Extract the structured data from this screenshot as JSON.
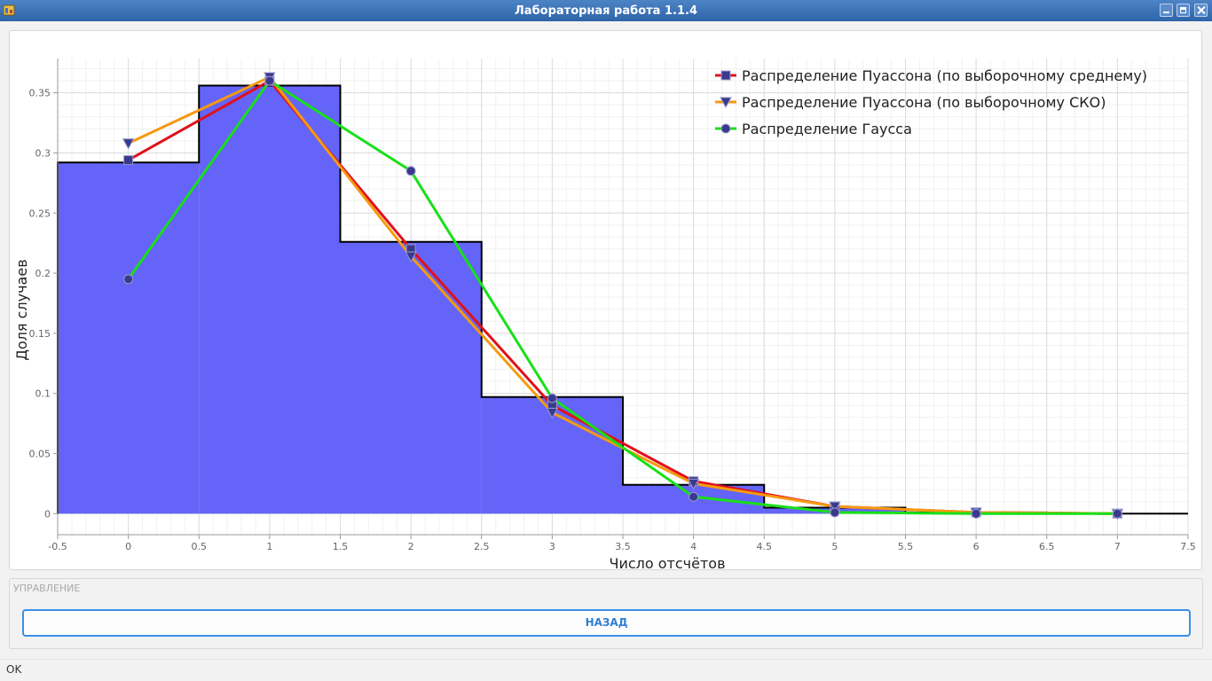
{
  "window": {
    "title": "Лабораторная работа 1.1.4"
  },
  "chart_data": {
    "type": "bar+line",
    "xlabel": "Число отсчётов",
    "ylabel": "Доля случаев",
    "xlim": [
      -0.5,
      7.5
    ],
    "ylim": [
      -0.0175,
      0.3785
    ],
    "x_ticks": [
      "-0.5",
      "0",
      "0.5",
      "1",
      "1.5",
      "2",
      "2.5",
      "3",
      "3.5",
      "4",
      "4.5",
      "5",
      "5.5",
      "6",
      "6.5",
      "7",
      "7.5"
    ],
    "y_ticks": [
      "0",
      "0.05",
      "0.1",
      "0.15",
      "0.2",
      "0.25",
      "0.3",
      "0.35"
    ],
    "grid": true,
    "legend_position": "top-right",
    "histogram": {
      "color": "#6464f8",
      "bins": [
        0,
        1,
        2,
        3,
        4,
        5,
        6,
        7
      ],
      "values": [
        0.292,
        0.356,
        0.226,
        0.097,
        0.024,
        0.005,
        0.001,
        0.0
      ]
    },
    "series": [
      {
        "name": "Распределение Пуассона (по выборочному среднему)",
        "color": "#e0101a",
        "marker": "square",
        "x": [
          0,
          1,
          2,
          3,
          4,
          5,
          6,
          7
        ],
        "values": [
          0.294,
          0.36,
          0.22,
          0.09,
          0.027,
          0.006,
          0.001,
          0.0
        ]
      },
      {
        "name": "Распределение Пуассона (по выборочному СКО)",
        "color": "#f59a10",
        "marker": "triangle-down",
        "x": [
          0,
          1,
          2,
          3,
          4,
          5,
          6,
          7
        ],
        "values": [
          0.308,
          0.363,
          0.214,
          0.084,
          0.025,
          0.006,
          0.001,
          0.0
        ]
      },
      {
        "name": "Распределение Гаусса",
        "color": "#18e018",
        "marker": "circle",
        "x": [
          0,
          1,
          2,
          3,
          4,
          5,
          6,
          7
        ],
        "values": [
          0.195,
          0.36,
          0.285,
          0.096,
          0.014,
          0.001,
          0.0,
          0.0
        ]
      }
    ]
  },
  "controls": {
    "group_title": "УПРАВЛЕНИЕ",
    "back_label": "НАЗАД"
  },
  "status": {
    "text": "OK"
  }
}
